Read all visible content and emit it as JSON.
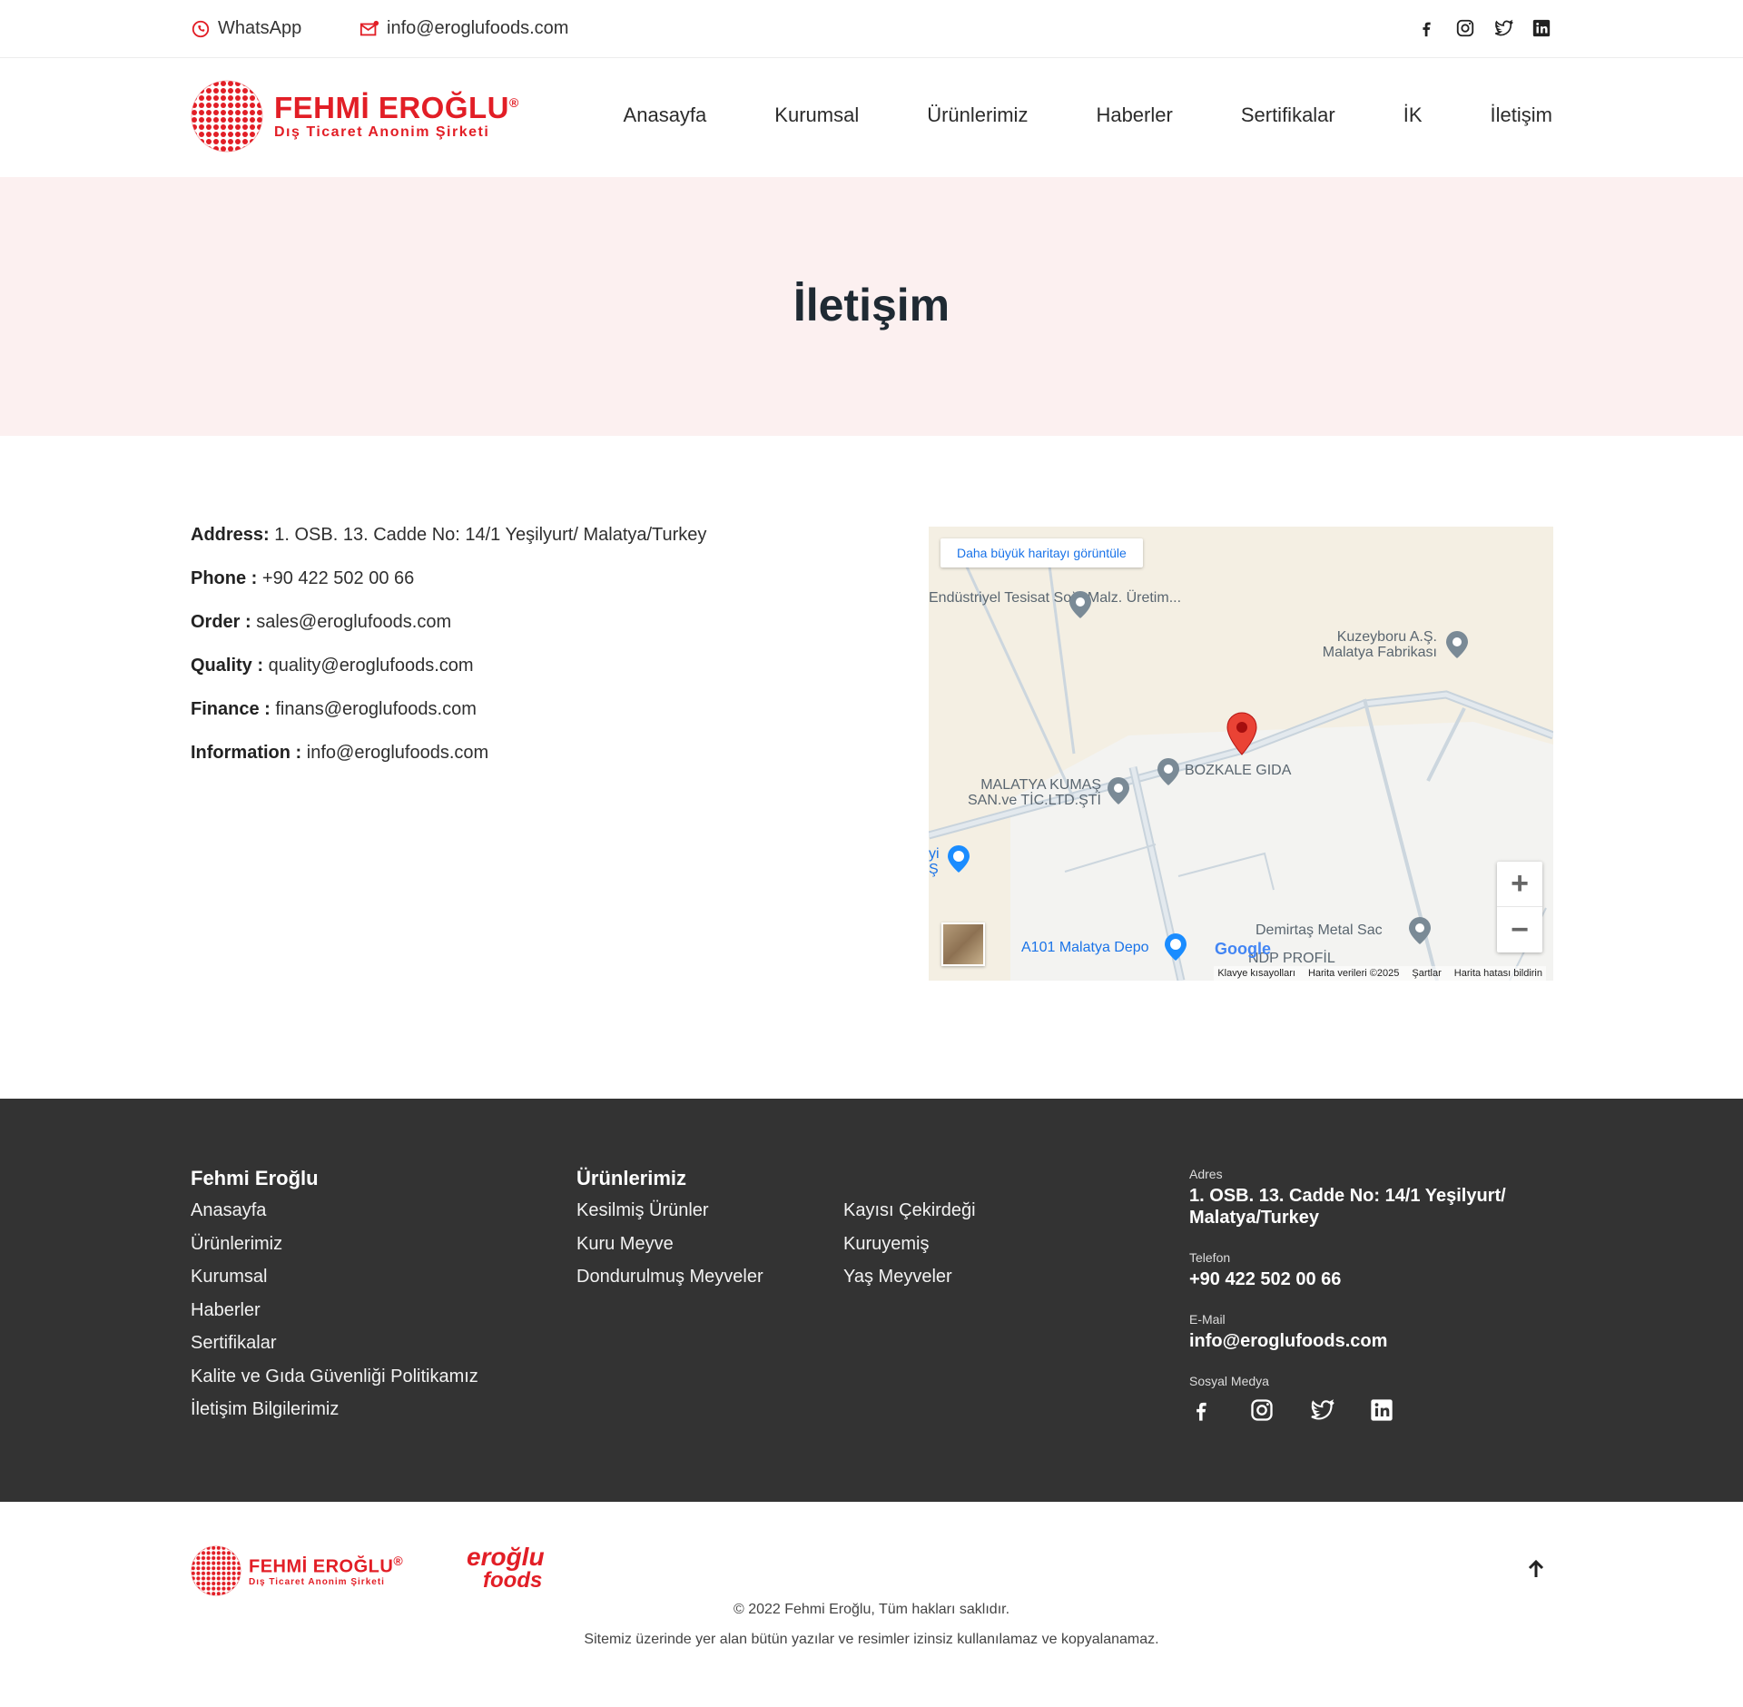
{
  "topbar": {
    "whatsapp_label": "WhatsApp",
    "email_label": "info@eroglufoods.com",
    "socials": [
      "facebook-icon",
      "instagram-icon",
      "twitter-icon",
      "linkedin-icon"
    ]
  },
  "header": {
    "logo_title": "FEHMİ EROĞLU",
    "logo_sub": "Dış Ticaret Anonim Şirketi",
    "nav": [
      "Anasayfa",
      "Kurumsal",
      "Ürünlerimiz",
      "Haberler",
      "Sertifikalar",
      "İK",
      "İletişim"
    ]
  },
  "hero": {
    "title": "İletişim"
  },
  "info": [
    {
      "label": "Address:",
      "value": " 1. OSB. 13. Cadde No: 14/1 Yeşilyurt/ Malatya/Turkey"
    },
    {
      "label": "Phone :",
      "value": " +90 422 502 00 66"
    },
    {
      "label": "Order :",
      "value": " sales@eroglufoods.com"
    },
    {
      "label": "Quality :",
      "value": " quality@eroglufoods.com"
    },
    {
      "label": "Finance :",
      "value": " finans@eroglufoods.com"
    },
    {
      "label": "Information :",
      "value": " info@eroglufoods.com"
    }
  ],
  "map": {
    "larger_map": "Daha büyük haritayı görüntüle",
    "labels": {
      "endustriyel": "Endüstriyel Tesisat Soğ. Malz. Üretim...",
      "kuzeyboru": "Kuzeyboru A.Ş. Malatya Fabrikası",
      "bozkale": "BOZKALE GIDA",
      "malatya_kumas": "MALATYA KUMAŞ SAN.ve TİC.LTD.ŞTİ",
      "demirtas": "Demirtaş Metal Sac",
      "a101": "A101 Malatya Depo",
      "ndp": "NDP PROFİL",
      "partial": "yi Ş"
    },
    "google": "Google",
    "footer_links": [
      "Klavye kısayolları",
      "Harita verileri ©2025",
      "Şartlar",
      "Harita hatası bildirin"
    ],
    "zoom_in": "+",
    "zoom_out": "−"
  },
  "footer": {
    "col1_title": "Fehmi Eroğlu",
    "col1_links": [
      "Anasayfa",
      "Ürünlerimiz",
      "Kurumsal",
      "Haberler",
      "Sertifikalar",
      "Kalite ve Gıda Güvenliği Politikamız",
      "İletişim Bilgilerimiz"
    ],
    "col2_title": "Ürünlerimiz",
    "col2_links": [
      "Kesilmiş Ürünler",
      "Kuru Meyve",
      "Dondurulmuş Meyveler"
    ],
    "col3_links": [
      "Kayısı Çekirdeği",
      "Kuruyemiş",
      "Yaş Meyveler"
    ],
    "address_label": "Adres",
    "address": "1. OSB. 13. Cadde No: 14/1 Yeşilyurt/ Malatya/Turkey",
    "phone_label": "Telefon",
    "phone": "+90 422 502 00 66",
    "email_label": "E-Mail",
    "email": "info@eroglufoods.com",
    "social_label": "Sosyal Medya"
  },
  "bottom": {
    "logo_title": "FEHMİ EROĞLU",
    "logo_sub": "Dış Ticaret Anonim Şirketi",
    "eroglu_line1": "eroğlu",
    "eroglu_line2": "foods",
    "copyright": "© 2022 Fehmi Eroğlu, Tüm hakları saklıdır.",
    "rights": "Sitemiz üzerinde yer alan bütün yazılar ve resimler izinsiz kullanılamaz ve kopyalanamaz."
  },
  "colors": {
    "brand_red": "#e21e26",
    "hero_bg": "#fcf0f0",
    "footer_bg": "#333333"
  }
}
